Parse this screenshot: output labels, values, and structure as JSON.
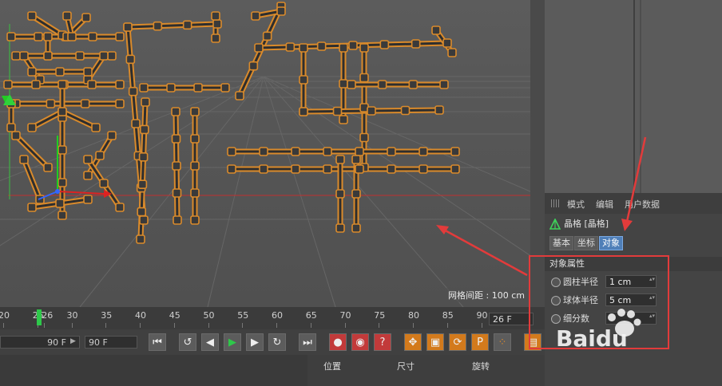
{
  "viewport": {
    "grid_spacing": "网格间距 : 100 cm"
  },
  "attr_manager": {
    "menu": [
      "模式",
      "编辑",
      "用户数据"
    ],
    "object_name": "晶格 [晶格]",
    "tabs": [
      {
        "label": "基本",
        "active": false
      },
      {
        "label": "坐标",
        "active": false
      },
      {
        "label": "对象",
        "active": true
      }
    ],
    "section": "对象属性",
    "props": [
      {
        "label": "圆柱半径",
        "value": "1 cm"
      },
      {
        "label": "球体半径",
        "value": "5 cm"
      },
      {
        "label": "细分数",
        "value": ""
      }
    ]
  },
  "timeline": {
    "ticks": [
      "20",
      "25",
      "26",
      "30",
      "35",
      "40",
      "45",
      "50",
      "55",
      "60",
      "65",
      "70",
      "75",
      "80",
      "85",
      "90"
    ],
    "current_frame": "26 F"
  },
  "transport": {
    "range_start": "90 F",
    "range_end": "90 F"
  },
  "coords": {
    "position": "位置",
    "size": "尺寸",
    "rotation": "旋转"
  },
  "watermark": {
    "text": "Baidu"
  },
  "colors": {
    "accent": "#4f7fb8",
    "annotation": "#e23b3b",
    "lattice_glow": "#d98a2b",
    "playhead": "#2ec84a"
  },
  "icons": {
    "object": "lattice-icon",
    "transport": [
      "first-frame-icon",
      "loop-back-icon",
      "step-back-icon",
      "play-icon",
      "step-forward-icon",
      "loop-forward-icon",
      "last-frame-icon",
      "record-icon",
      "autokey-icon",
      "help-icon",
      "move-icon",
      "scale-icon",
      "rotate-icon",
      "param-icon",
      "grid-dots-icon",
      "timeline-icon"
    ]
  }
}
